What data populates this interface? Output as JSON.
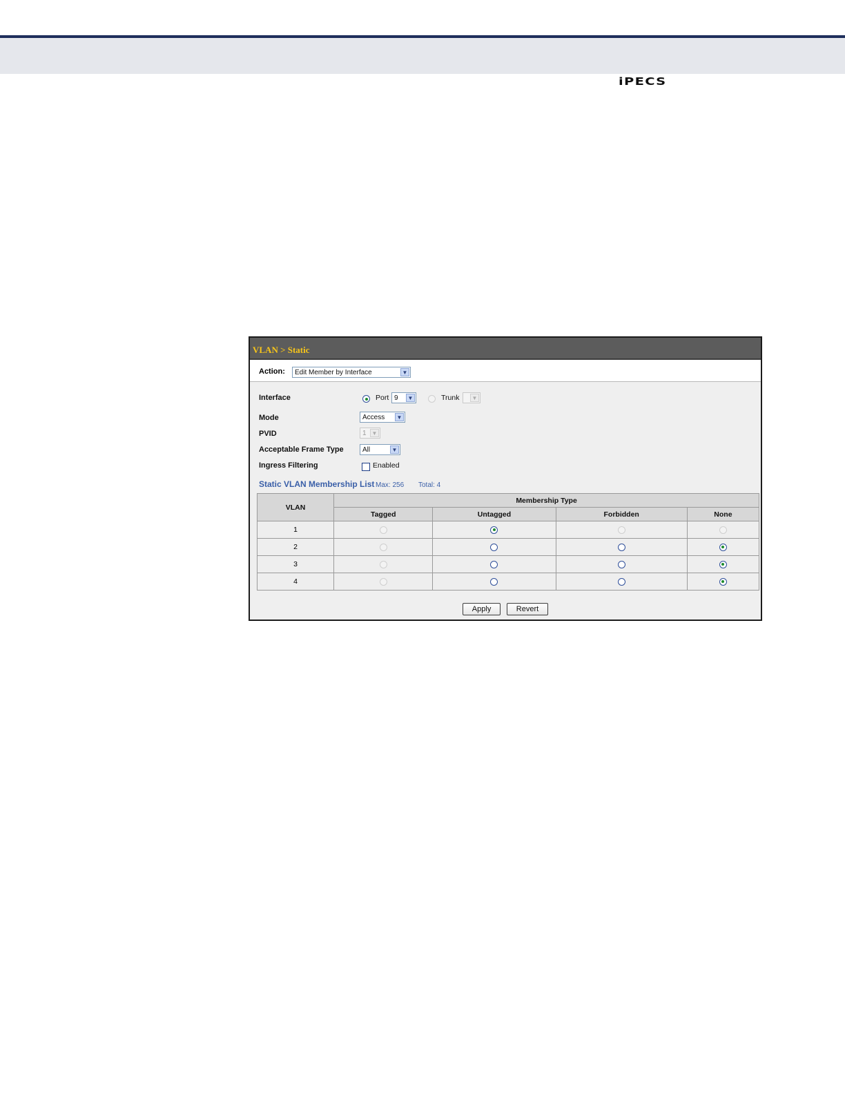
{
  "logo": {
    "text": "iPECS"
  },
  "panel": {
    "title": "VLAN > Static",
    "action": {
      "label": "Action:",
      "value": "Edit Member by Interface"
    },
    "interface": {
      "label": "Interface",
      "port_label": "Port",
      "port_value": "9",
      "trunk_label": "Trunk",
      "trunk_value": "",
      "selected": "port"
    },
    "mode": {
      "label": "Mode",
      "value": "Access"
    },
    "pvid": {
      "label": "PVID",
      "value": "1"
    },
    "frame_type": {
      "label": "Acceptable Frame Type",
      "value": "All"
    },
    "ingress": {
      "label": "Ingress Filtering",
      "checkbox_label": "Enabled",
      "checked": false
    },
    "list": {
      "title": "Static VLAN Membership List",
      "max": "Max: 256",
      "total": "Total: 4",
      "headers": {
        "vlan": "VLAN",
        "membership_type": "Membership Type",
        "tagged": "Tagged",
        "untagged": "Untagged",
        "forbidden": "Forbidden",
        "none": "None"
      },
      "rows": [
        {
          "vlan": "1",
          "selected": "untagged",
          "disabled": [
            "tagged",
            "forbidden",
            "none"
          ]
        },
        {
          "vlan": "2",
          "selected": "none",
          "disabled": [
            "tagged"
          ]
        },
        {
          "vlan": "3",
          "selected": "none",
          "disabled": [
            "tagged"
          ]
        },
        {
          "vlan": "4",
          "selected": "none",
          "disabled": [
            "tagged"
          ]
        }
      ]
    },
    "buttons": {
      "apply": "Apply",
      "revert": "Revert"
    }
  }
}
